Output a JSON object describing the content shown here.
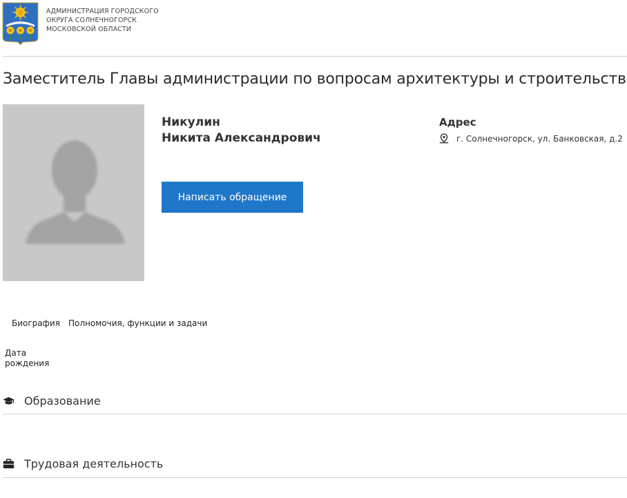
{
  "header": {
    "org_name_lines": [
      "АДМИНИСТРАЦИЯ ГОРОДСКОГО",
      "ОКРУГА СОЛНЕЧНОГОРСК",
      "МОСКОВСКОЙ ОБЛАСТИ"
    ],
    "logo_icon": "coat-of-arms-icon"
  },
  "page": {
    "title": "Заместитель Главы администрации по вопросам архитектуры и строительства"
  },
  "person": {
    "surname": "Никулин",
    "given_names": "Никита Александрович",
    "photo_icon": "avatar-placeholder-icon"
  },
  "actions": {
    "write_button": "Написать обращение"
  },
  "address": {
    "heading": "Адрес",
    "value": "г. Солнечногорск, ул. Банковская, д.2",
    "icon": "map-pin-icon"
  },
  "tabs": [
    {
      "label": "Биография"
    },
    {
      "label": "Полномочия, функции и задачи"
    }
  ],
  "biography": {
    "dob_label_line1": "Дата",
    "dob_label_line2": "рождения"
  },
  "sections": [
    {
      "label": "Образование",
      "icon": "graduation-cap-icon"
    },
    {
      "label": "Трудовая деятельность",
      "icon": "briefcase-icon"
    }
  ],
  "colors": {
    "accent": "#1f77c9",
    "divider": "#cfcfcf",
    "photo_bg": "#c8c8c8"
  }
}
